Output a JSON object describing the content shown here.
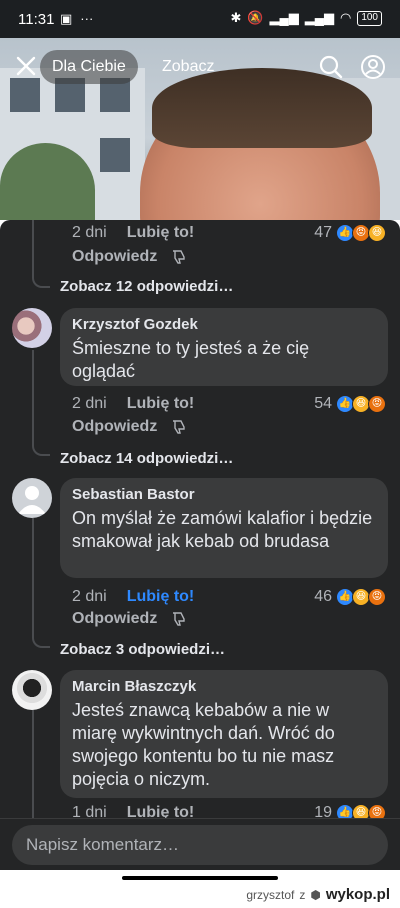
{
  "status": {
    "time": "11:31",
    "battery": "100"
  },
  "video_header": {
    "tab_active": "Dla Ciebie",
    "tab_other": "Zobacz"
  },
  "comments": [
    {
      "time": "2 dni",
      "like": "Lubię to!",
      "reply": "Odpowiedz",
      "count": "47",
      "reactions": [
        "like",
        "angry",
        "haha"
      ],
      "view_replies": "Zobacz 12 odpowiedzi…"
    },
    {
      "author": "Krzysztof Gozdek",
      "text": "Śmieszne to ty jesteś a że cię oglądać",
      "time": "2 dni",
      "like": "Lubię to!",
      "reply": "Odpowiedz",
      "count": "54",
      "reactions": [
        "like",
        "haha",
        "angry"
      ],
      "view_replies": "Zobacz 14 odpowiedzi…"
    },
    {
      "author": "Sebastian Bastor",
      "text": "On myślał że zamówi kalafior i będzie smakował jak kebab od brudasa",
      "time": "2 dni",
      "like": "Lubię to!",
      "like_active": true,
      "reply": "Odpowiedz",
      "count": "46",
      "reactions": [
        "like",
        "haha",
        "angry"
      ],
      "view_replies": "Zobacz 3 odpowiedzi…"
    },
    {
      "author": "Marcin Błaszczyk",
      "text": "Jesteś znawcą kebabów a nie w miarę wykwintnych dań. Wróć do swojego kontentu bo tu nie masz pojęcia o niczym.",
      "time": "1 dni",
      "like": "Lubię to!",
      "count": "19",
      "reactions": [
        "like",
        "haha",
        "angry"
      ]
    }
  ],
  "input": {
    "placeholder": "Napisz komentarz…"
  },
  "credit": {
    "user": "grzysztof",
    "sep": "z",
    "site": "wykop.pl"
  },
  "colors": {
    "sheet": "#242526",
    "bubble": "#3a3b3c",
    "accent": "#2e89ff"
  }
}
